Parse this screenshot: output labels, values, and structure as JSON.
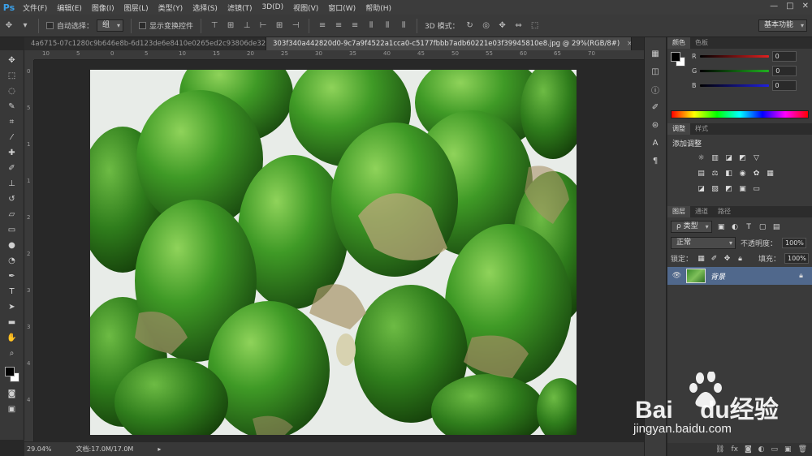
{
  "app": {
    "logo": "Ps"
  },
  "menu": [
    "文件(F)",
    "编辑(E)",
    "图像(I)",
    "图层(L)",
    "类型(Y)",
    "选择(S)",
    "滤镜(T)",
    "3D(D)",
    "视图(V)",
    "窗口(W)",
    "帮助(H)"
  ],
  "window_controls": {
    "minimize": "—",
    "maximize": "□",
    "close": "✕"
  },
  "options_bar": {
    "auto_select_label": "自动选择：",
    "auto_select_value": "组",
    "show_transform_label": "显示变换控件",
    "mode_3d_label": "3D 模式：",
    "workspace": "基本功能"
  },
  "tabs": [
    {
      "label": "4a6715-07c1280c9b646e8b-6d123de6e8410e0265ed2c93806de329.jpg",
      "active": false,
      "close": "×"
    },
    {
      "label": "303f340a442820d0-9c7a9f4522a1cca0-c5177fbbb7adb60221e03f39945810e8.jpg @ 29%(RGB/8#)",
      "active": true,
      "close": "×"
    }
  ],
  "ruler_h": [
    "10",
    "5",
    "0",
    "5",
    "10",
    "15",
    "20",
    "25",
    "30",
    "35",
    "40",
    "45",
    "50",
    "55",
    "60",
    "65",
    "70"
  ],
  "ruler_v": [
    "0",
    "5",
    "1",
    "1",
    "2",
    "2",
    "3",
    "3",
    "4",
    "4"
  ],
  "status": {
    "zoom": "29.04%",
    "doc": "文档:17.0M/17.0M"
  },
  "color_panel": {
    "tabs": [
      "颜色",
      "色板"
    ],
    "channels": [
      {
        "label": "R",
        "value": "0",
        "color": "#e02020"
      },
      {
        "label": "G",
        "value": "0",
        "color": "#20b020"
      },
      {
        "label": "B",
        "value": "0",
        "color": "#2020e0"
      }
    ]
  },
  "adjust_panel": {
    "tabs": [
      "调整",
      "样式"
    ],
    "title": "添加调整"
  },
  "layers_panel": {
    "tabs": [
      "图层",
      "通道",
      "路径"
    ],
    "filter_label": "ρ 类型",
    "blend_mode": "正常",
    "opacity_label": "不透明度：",
    "opacity_value": "100%",
    "lock_label": "锁定：",
    "fill_label": "填充：",
    "fill_value": "100%",
    "layer_name": "背景"
  },
  "watermark": {
    "brand": "Bai",
    "brand2": "du",
    "brand3": "经验",
    "url": "jingyan.baidu.com"
  }
}
